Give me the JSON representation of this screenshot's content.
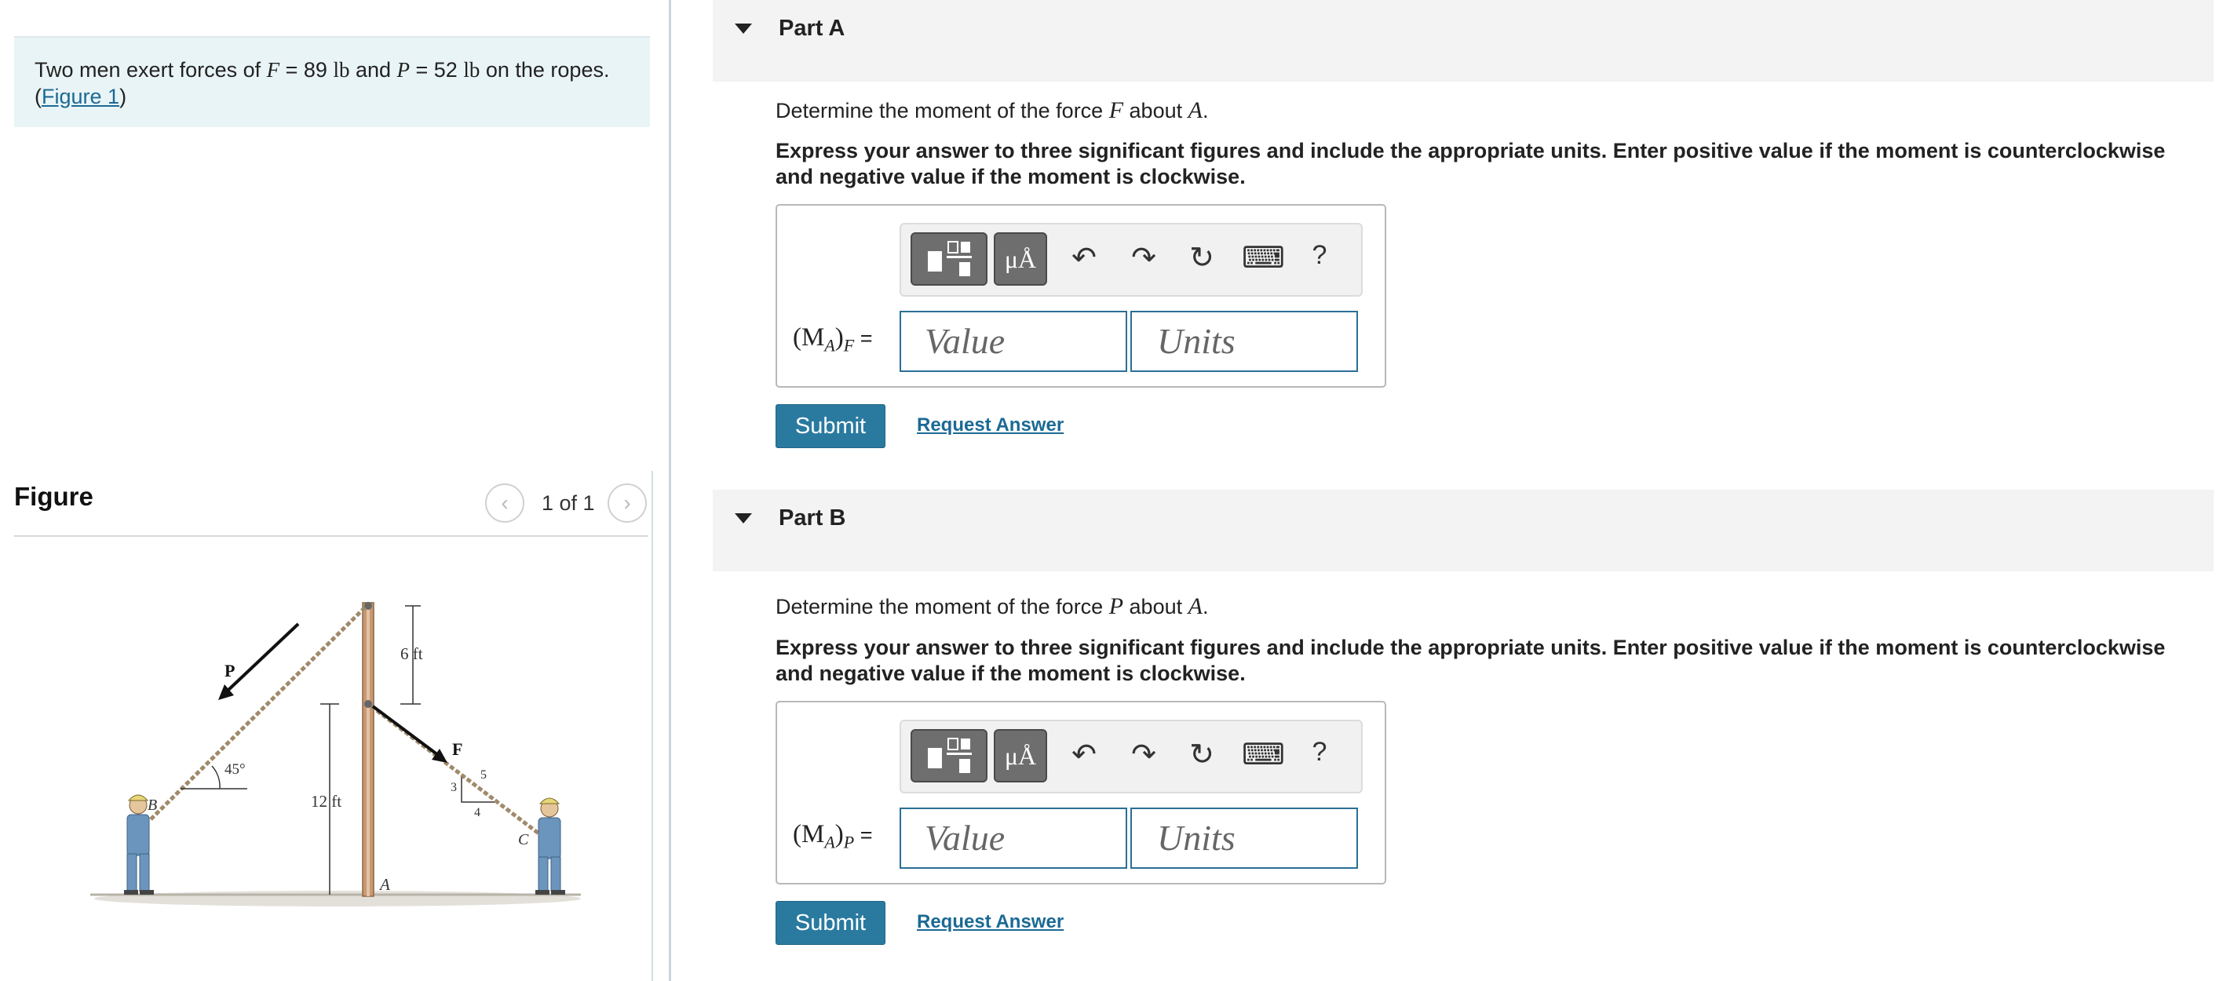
{
  "problem": {
    "intro": "Two men exert forces of ",
    "F_sym": "F",
    "F_eq": " = 89 ",
    "F_unit": "lb",
    "and": " and ",
    "P_sym": "P",
    "P_eq": " = 52 ",
    "P_unit": "lb",
    "tail": " on the ropes.",
    "paren_open": "(",
    "figure_link": "Figure 1",
    "paren_close": ")"
  },
  "figure": {
    "title": "Figure",
    "counter": "1 of 1",
    "labels": {
      "P": "P",
      "F": "F",
      "B": "B",
      "C": "C",
      "A": "A",
      "six_ft": "6 ft",
      "twelve_ft": "12 ft",
      "angle": "45°",
      "tri_3": "3",
      "tri_4": "4",
      "tri_5": "5"
    }
  },
  "parts": [
    {
      "label": "Part A",
      "question_pre": "Determine the moment of the force ",
      "question_force": "F",
      "question_mid": " about ",
      "question_point": "A",
      "question_end": ".",
      "instruction": "Express your answer to three significant figures and include the appropriate units. Enter positive value if the moment is counterclockwise and negative value if the moment is clockwise.",
      "eq_open": "(M",
      "eq_sub": "A",
      "eq_close": ")",
      "eq_subscript": "F",
      "eq_equals": " =",
      "value_placeholder": "Value",
      "units_placeholder": "Units",
      "submit": "Submit",
      "request": "Request Answer"
    },
    {
      "label": "Part B",
      "question_pre": "Determine the moment of the force ",
      "question_force": "P",
      "question_mid": " about ",
      "question_point": "A",
      "question_end": ".",
      "instruction": "Express your answer to three significant figures and include the appropriate units. Enter positive value if the moment is counterclockwise and negative value if the moment is clockwise.",
      "eq_open": "(M",
      "eq_sub": "A",
      "eq_close": ")",
      "eq_subscript": "P",
      "eq_equals": " =",
      "value_placeholder": "Value",
      "units_placeholder": "Units",
      "submit": "Submit",
      "request": "Request Answer"
    }
  ],
  "toolbar": {
    "units_glyph": "μÅ",
    "undo_icon": "↶",
    "redo_icon": "↷",
    "reset_icon": "↻",
    "keyboard_icon": "⌨",
    "help": "?"
  }
}
